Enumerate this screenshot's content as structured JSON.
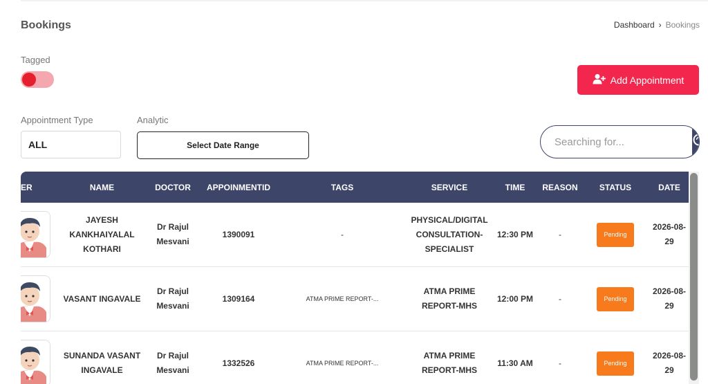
{
  "header": {
    "title": "Bookings"
  },
  "breadcrumb": {
    "home": "Dashboard",
    "separator": "›",
    "current": "Bookings"
  },
  "filters": {
    "tagged_label": "Tagged",
    "tagged_on": true,
    "appointment_type_label": "Appointment Type",
    "appointment_type_value": "ALL",
    "analytic_label": "Analytic",
    "date_range_label": "Select Date Range"
  },
  "actions": {
    "add_appointment_label": "Add Appointment"
  },
  "search": {
    "placeholder": "Searching for..."
  },
  "table": {
    "columns": [
      "USER",
      "NAME",
      "DOCTOR",
      "APPOINMENTID",
      "TAGS",
      "SERVICE",
      "TIME",
      "REASON",
      "STATUS",
      "DATE"
    ],
    "rows": [
      {
        "name": "JAYESH KANKHAIYALAL KOTHARI",
        "doctor": "Dr Rajul Mesvani",
        "id": "1390091",
        "tags": "-",
        "service": "PHYSICAL/DIGITAL CONSULTATION-SPECIALIST",
        "time": "12:30 PM",
        "reason": "-",
        "status": "Pending",
        "date": "2026-08-29"
      },
      {
        "name": "VASANT INGAVALE",
        "doctor": "Dr Rajul Mesvani",
        "id": "1309164",
        "tags": "ATMA PRIME REPORT-...",
        "service": "ATMA PRIME REPORT-MHS",
        "time": "12:00 PM",
        "reason": "-",
        "status": "Pending",
        "date": "2026-08-29"
      },
      {
        "name": "SUNANDA VASANT INGAVALE",
        "doctor": "Dr Rajul Mesvani",
        "id": "1332526",
        "tags": "ATMA PRIME REPORT-...",
        "service": "ATMA PRIME REPORT-MHS",
        "time": "11:30 AM",
        "reason": "-",
        "status": "Pending",
        "date": "2026-08-29"
      }
    ]
  },
  "colors": {
    "header_bg": "#3d4569",
    "accent": "#f3264d",
    "pending": "#f77a1c",
    "toggle_knob": "#e5202e",
    "toggle_track": "#f4a7ae"
  },
  "icons": {
    "add_user": "user-plus-icon",
    "search": "search-icon",
    "avatar": "user-avatar-icon"
  }
}
